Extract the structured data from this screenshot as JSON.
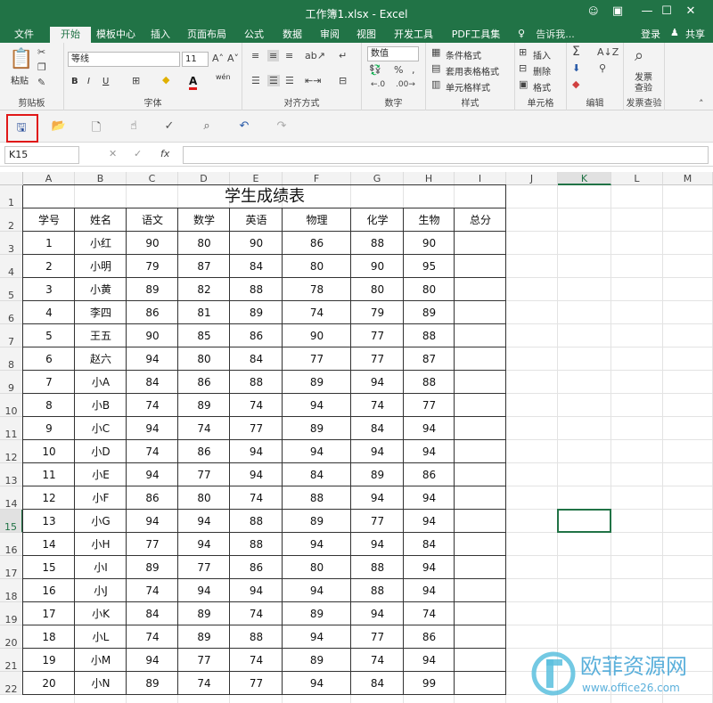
{
  "window": {
    "title": "工作簿1.xlsx - Excel"
  },
  "tabs": [
    "文件",
    "开始",
    "模板中心",
    "插入",
    "页面布局",
    "公式",
    "数据",
    "审阅",
    "视图",
    "开发工具",
    "PDF工具集"
  ],
  "active_tab_index": 1,
  "tell_me": "告诉我...",
  "login": "登录",
  "share": "共享",
  "ribbon": {
    "paste": "粘贴",
    "clipboard": "剪贴板",
    "font_name": "等线",
    "font_size": "11",
    "font_group": "字体",
    "align_group": "对齐方式",
    "number_format": "数值",
    "number_group": "数字",
    "cond_format": "条件格式",
    "table_format": "套用表格格式",
    "cell_style": "单元格样式",
    "style_group": "样式",
    "insert": "插入",
    "delete": "删除",
    "format": "格式",
    "cells_group": "单元格",
    "edit_group": "编辑",
    "invoice_check": "发票查验",
    "invoice_line1": "发票",
    "invoice_line2": "查验",
    "bold": "B",
    "italic": "I",
    "underline": "U",
    "font_a": "A",
    "wen": "wén"
  },
  "name_box": "K15",
  "fx_label": "fx",
  "columns": [
    "A",
    "B",
    "C",
    "D",
    "E",
    "F",
    "G",
    "H",
    "I",
    "J",
    "K",
    "L",
    "M"
  ],
  "rows": [
    "1",
    "2",
    "3",
    "4",
    "5",
    "6",
    "7",
    "8",
    "9",
    "10",
    "11",
    "12",
    "13",
    "14",
    "15",
    "16",
    "17",
    "18",
    "19",
    "20",
    "21",
    "22"
  ],
  "table_title": "学生成绩表",
  "headers": [
    "学号",
    "姓名",
    "语文",
    "数学",
    "英语",
    "物理",
    "化学",
    "生物",
    "总分"
  ],
  "records": [
    [
      "1",
      "小红",
      "90",
      "80",
      "90",
      "86",
      "88",
      "90",
      ""
    ],
    [
      "2",
      "小明",
      "79",
      "87",
      "84",
      "80",
      "90",
      "95",
      ""
    ],
    [
      "3",
      "小黄",
      "89",
      "82",
      "88",
      "78",
      "80",
      "80",
      ""
    ],
    [
      "4",
      "李四",
      "86",
      "81",
      "89",
      "74",
      "79",
      "89",
      ""
    ],
    [
      "5",
      "王五",
      "90",
      "85",
      "86",
      "90",
      "77",
      "88",
      ""
    ],
    [
      "6",
      "赵六",
      "94",
      "80",
      "84",
      "77",
      "77",
      "87",
      ""
    ],
    [
      "7",
      "小A",
      "84",
      "86",
      "88",
      "89",
      "94",
      "88",
      ""
    ],
    [
      "8",
      "小B",
      "74",
      "89",
      "74",
      "94",
      "74",
      "77",
      ""
    ],
    [
      "9",
      "小C",
      "94",
      "74",
      "77",
      "89",
      "84",
      "94",
      ""
    ],
    [
      "10",
      "小D",
      "74",
      "86",
      "94",
      "94",
      "94",
      "94",
      ""
    ],
    [
      "11",
      "小E",
      "94",
      "77",
      "94",
      "84",
      "89",
      "86",
      ""
    ],
    [
      "12",
      "小F",
      "86",
      "80",
      "74",
      "88",
      "94",
      "94",
      ""
    ],
    [
      "13",
      "小G",
      "94",
      "94",
      "88",
      "89",
      "77",
      "94",
      ""
    ],
    [
      "14",
      "小H",
      "77",
      "94",
      "88",
      "94",
      "94",
      "84",
      ""
    ],
    [
      "15",
      "小I",
      "89",
      "77",
      "86",
      "80",
      "88",
      "94",
      ""
    ],
    [
      "16",
      "小J",
      "74",
      "94",
      "94",
      "94",
      "88",
      "94",
      ""
    ],
    [
      "17",
      "小K",
      "84",
      "89",
      "74",
      "89",
      "94",
      "74",
      ""
    ],
    [
      "18",
      "小L",
      "74",
      "89",
      "88",
      "94",
      "77",
      "86",
      ""
    ],
    [
      "19",
      "小M",
      "94",
      "77",
      "74",
      "89",
      "74",
      "94",
      ""
    ],
    [
      "20",
      "小N",
      "89",
      "74",
      "77",
      "94",
      "84",
      "99",
      ""
    ]
  ],
  "watermark": {
    "brand": "欧菲资源网",
    "url": "www.office26.com"
  },
  "colors": {
    "excel_green": "#217346",
    "highlight": "#e01818",
    "watermark": "#5bc0de"
  }
}
